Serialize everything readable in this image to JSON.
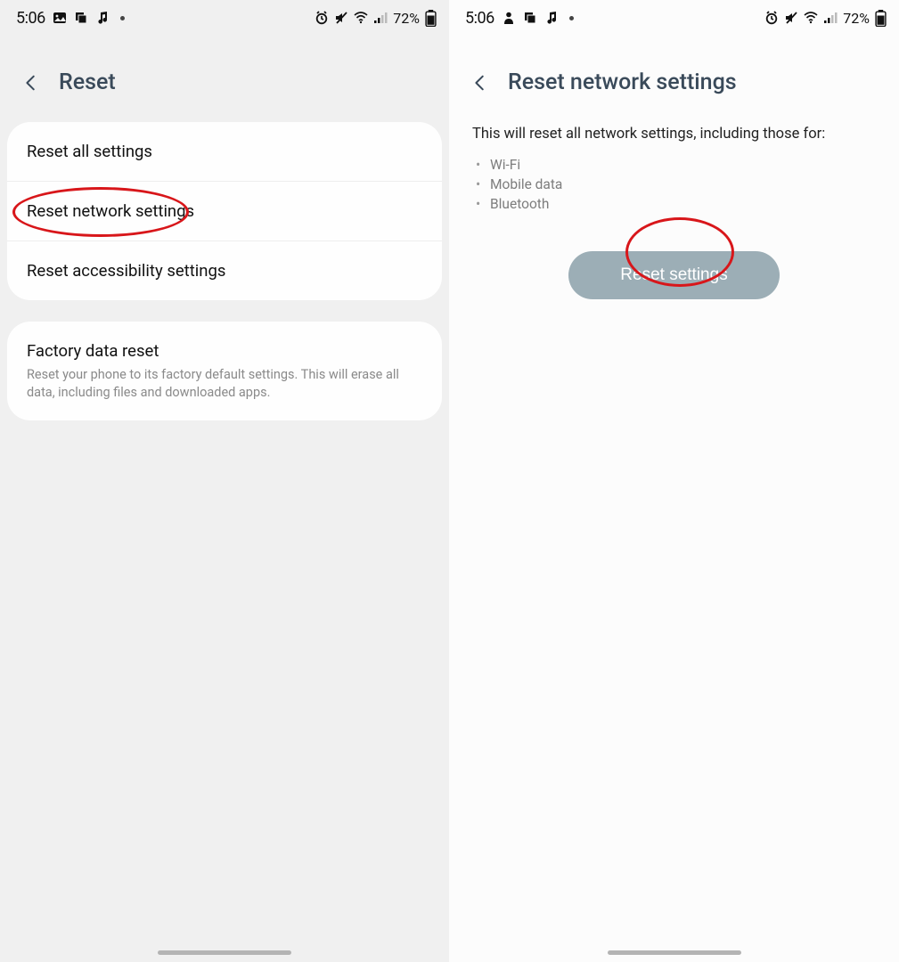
{
  "status": {
    "time": "5:06",
    "battery_percent": "72%",
    "icons_left": [
      "image-icon",
      "overlay-icon",
      "music-icon"
    ],
    "icons_right": [
      "alarm-icon",
      "mute-icon",
      "wifi-icon",
      "signal-icon"
    ]
  },
  "left_screen": {
    "title": "Reset",
    "group1": {
      "items": [
        {
          "label": "Reset all settings"
        },
        {
          "label": "Reset network settings"
        },
        {
          "label": "Reset accessibility settings"
        }
      ]
    },
    "group2": {
      "title": "Factory data reset",
      "subtitle": "Reset your phone to its factory default settings. This will erase all data, including files and downloaded apps."
    }
  },
  "right_screen": {
    "title": "Reset network settings",
    "description": "This will reset all network settings, including those for:",
    "bullets": [
      "Wi-Fi",
      "Mobile data",
      "Bluetooth"
    ],
    "button_label": "Reset settings"
  },
  "annotations": {
    "left_highlight_item_index": 1,
    "right_highlight_button": true,
    "ellipse_color": "#d8161a"
  }
}
